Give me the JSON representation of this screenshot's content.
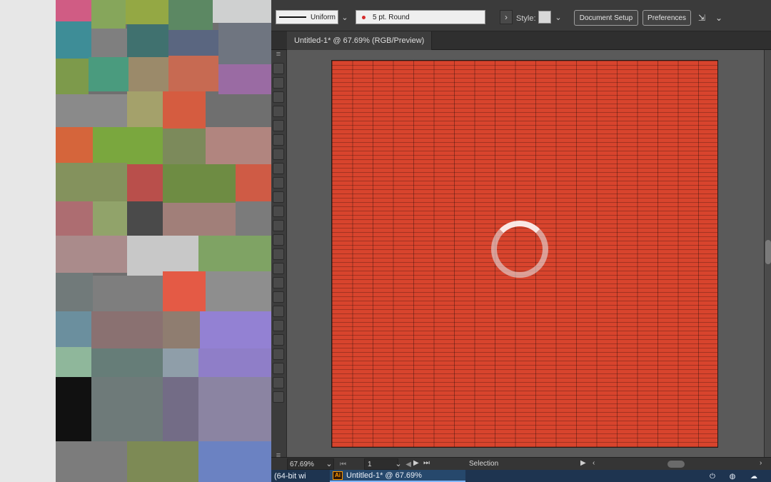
{
  "control_bar": {
    "stroke_profile_label": "Uniform",
    "brush_label": "5 pt. Round",
    "arrow_label": "›",
    "style_label": "Style:",
    "document_setup_label": "Document Setup",
    "preferences_label": "Preferences"
  },
  "document": {
    "tab_title": "Untitled-1* @ 67.69% (RGB/Preview)"
  },
  "status_bar": {
    "zoom_value": "67.69%",
    "page_value": "1",
    "tool_status": "Selection"
  },
  "taskbar": {
    "left_item_label": "(64-bit wi",
    "active_item_label": "Untitled-1* @ 67.69%"
  },
  "icons": {
    "chevron": "chevron-down-icon",
    "nav_first": "first-page-icon",
    "nav_prev": "previous-page-icon",
    "nav_next": "next-page-icon",
    "nav_last": "last-page-icon",
    "tray_1": "power-icon",
    "tray_2": "chat-icon",
    "tray_3": "cloud-icon"
  },
  "colors": {
    "artboard_fill": "#d8442d",
    "app_background": "#535353",
    "taskbar_background": "#1e3450"
  }
}
